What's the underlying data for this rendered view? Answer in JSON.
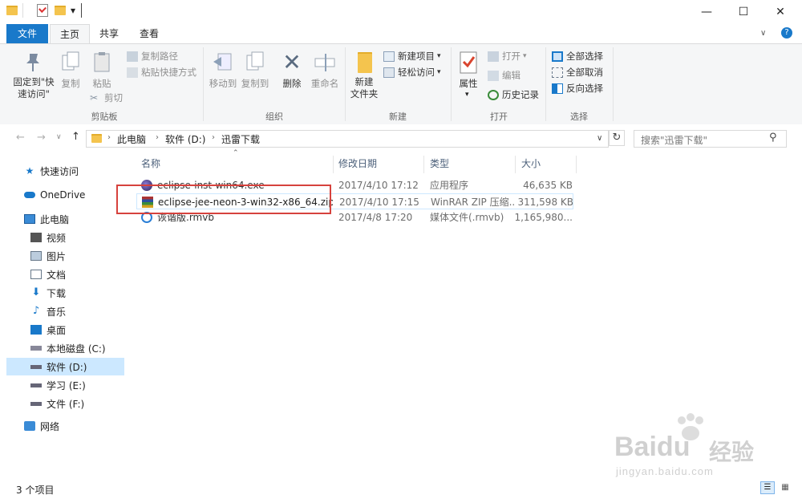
{
  "qat": {
    "properties_icon": "properties-icon",
    "dropdown": "▾"
  },
  "window": {
    "minimize": "—",
    "maximize": "☐",
    "close": "✕"
  },
  "tabs": [
    {
      "label": "文件",
      "active": false,
      "file_tab": true
    },
    {
      "label": "主页",
      "active": true
    },
    {
      "label": "共享",
      "active": false
    },
    {
      "label": "查看",
      "active": false
    }
  ],
  "ribbon": {
    "pin_label": "固定到\"快\n速访问\"",
    "copy_label": "复制",
    "paste_label": "粘贴",
    "copy_path": "复制路径",
    "paste_shortcut": "粘贴快捷方式",
    "cut": "剪切",
    "clipboard_group": "剪贴板",
    "move_to": "移动到",
    "copy_to": "复制到",
    "delete": "删除",
    "rename": "重命名",
    "organize_group": "组织",
    "new_folder": "新建\n文件夹",
    "new_item": "新建项目",
    "easy_access": "轻松访问",
    "new_group": "新建",
    "properties": "属性",
    "open": "打开",
    "edit": "编辑",
    "history": "历史记录",
    "open_group": "打开",
    "select_all": "全部选择",
    "select_none": "全部取消",
    "invert_selection": "反向选择",
    "select_group": "选择"
  },
  "address": {
    "crumbs": [
      "此电脑",
      "软件 (D:)",
      "迅雷下载"
    ],
    "search_placeholder": "搜索\"迅雷下载\""
  },
  "nav": [
    {
      "label": "快速访问",
      "icon": "star-icon",
      "sel": false
    },
    {
      "label": "OneDrive",
      "icon": "cloud-icon",
      "sel": false
    },
    {
      "label": "此电脑",
      "icon": "computer-icon",
      "sel": false
    },
    {
      "label": "视频",
      "icon": "video-icon",
      "sel": false
    },
    {
      "label": "图片",
      "icon": "picture-icon",
      "sel": false
    },
    {
      "label": "文档",
      "icon": "document-icon",
      "sel": false
    },
    {
      "label": "下载",
      "icon": "download-icon",
      "sel": false
    },
    {
      "label": "音乐",
      "icon": "music-icon",
      "sel": false
    },
    {
      "label": "桌面",
      "icon": "desktop-icon",
      "sel": false
    },
    {
      "label": "本地磁盘 (C:)",
      "icon": "drive-c-icon",
      "sel": false
    },
    {
      "label": "软件 (D:)",
      "icon": "drive-icon",
      "sel": true
    },
    {
      "label": "学习 (E:)",
      "icon": "drive-icon",
      "sel": false
    },
    {
      "label": "文件 (F:)",
      "icon": "drive-icon",
      "sel": false
    },
    {
      "label": "网络",
      "icon": "network-icon",
      "sel": false
    }
  ],
  "columns": {
    "name": "名称",
    "date": "修改日期",
    "type": "类型",
    "size": "大小"
  },
  "files": [
    {
      "name": "eclipse-inst-win64.exe",
      "date": "2017/4/10 17:12",
      "type": "应用程序",
      "size": "46,635 KB",
      "icon": "eclipse-icon"
    },
    {
      "name": "eclipse-jee-neon-3-win32-x86_64.zip",
      "date": "2017/4/10 17:15",
      "type": "WinRAR ZIP 压缩...",
      "size": "311,598 KB",
      "icon": "winrar-icon"
    },
    {
      "name": "诙谐版.rmvb",
      "date": "2017/4/8 17:20",
      "type": "媒体文件(.rmvb)",
      "size": "1,165,980...",
      "icon": "media-icon"
    }
  ],
  "status": {
    "count": "3 个项目"
  },
  "watermark": {
    "brand": "Bai",
    "brand_tail": "du",
    "cn": "经验",
    "url": "jingyan.baidu.com"
  },
  "colors": {
    "accent": "#1979ca",
    "selection": "#cce8ff",
    "highlight_border": "#d6423d"
  }
}
